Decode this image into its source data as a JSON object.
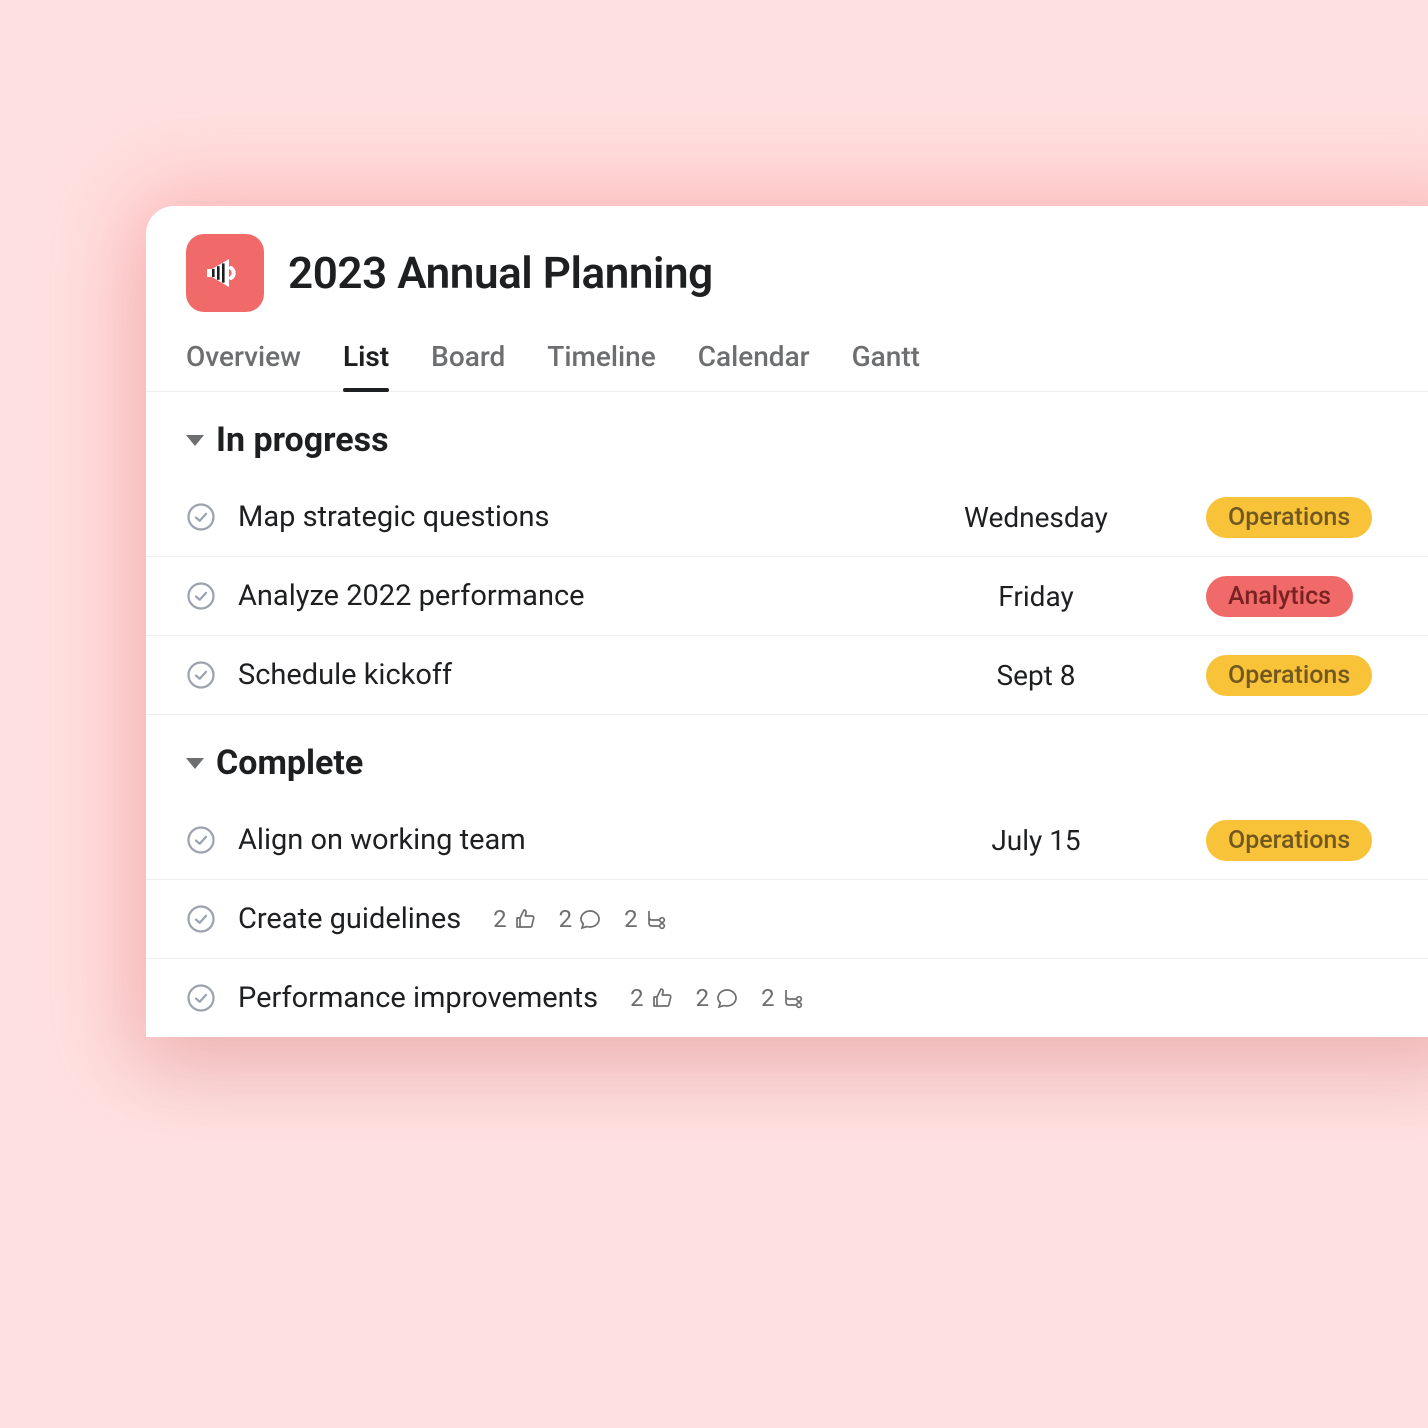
{
  "project": {
    "title": "2023 Annual Planning"
  },
  "tabs": {
    "overview": "Overview",
    "list": "List",
    "board": "Board",
    "timeline": "Timeline",
    "calendar": "Calendar",
    "gantt": "Gantt"
  },
  "sections": {
    "in_progress": {
      "title": "In progress",
      "tasks": [
        {
          "name": "Map strategic questions",
          "date": "Wednesday",
          "tag": "Operations"
        },
        {
          "name": "Analyze 2022 performance",
          "date": "Friday",
          "tag": "Analytics"
        },
        {
          "name": "Schedule kickoff",
          "date": "Sept 8",
          "tag": "Operations"
        }
      ]
    },
    "complete": {
      "title": "Complete",
      "tasks": [
        {
          "name": "Align on working team",
          "date": "July 15",
          "tag": "Operations"
        },
        {
          "name": "Create guidelines",
          "likes": "2",
          "comments": "2",
          "subtasks": "2"
        },
        {
          "name": "Performance improvements",
          "likes": "2",
          "comments": "2",
          "subtasks": "2"
        }
      ]
    }
  }
}
